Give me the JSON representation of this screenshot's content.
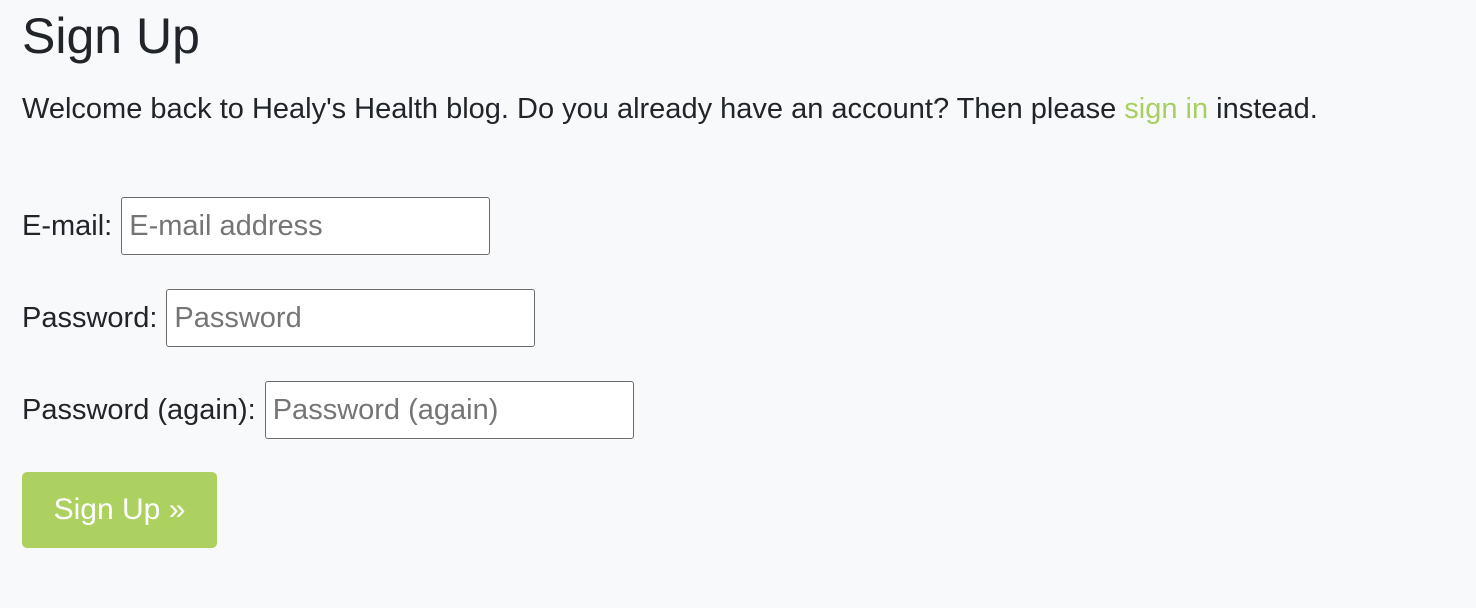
{
  "page": {
    "title": "Sign Up",
    "intro_before": "Welcome back to Healy's Health blog. Do you already have an account? Then please ",
    "intro_link": "sign in",
    "intro_after": " instead."
  },
  "form": {
    "email": {
      "label": "E-mail:",
      "placeholder": "E-mail address",
      "value": ""
    },
    "password": {
      "label": "Password:",
      "placeholder": "Password",
      "value": ""
    },
    "password_again": {
      "label": "Password (again):",
      "placeholder": "Password (again)",
      "value": ""
    },
    "submit_label": "Sign Up »"
  },
  "colors": {
    "accent": "#add160",
    "link": "#a8d060",
    "background": "#f8f9fb",
    "text": "#212529"
  }
}
